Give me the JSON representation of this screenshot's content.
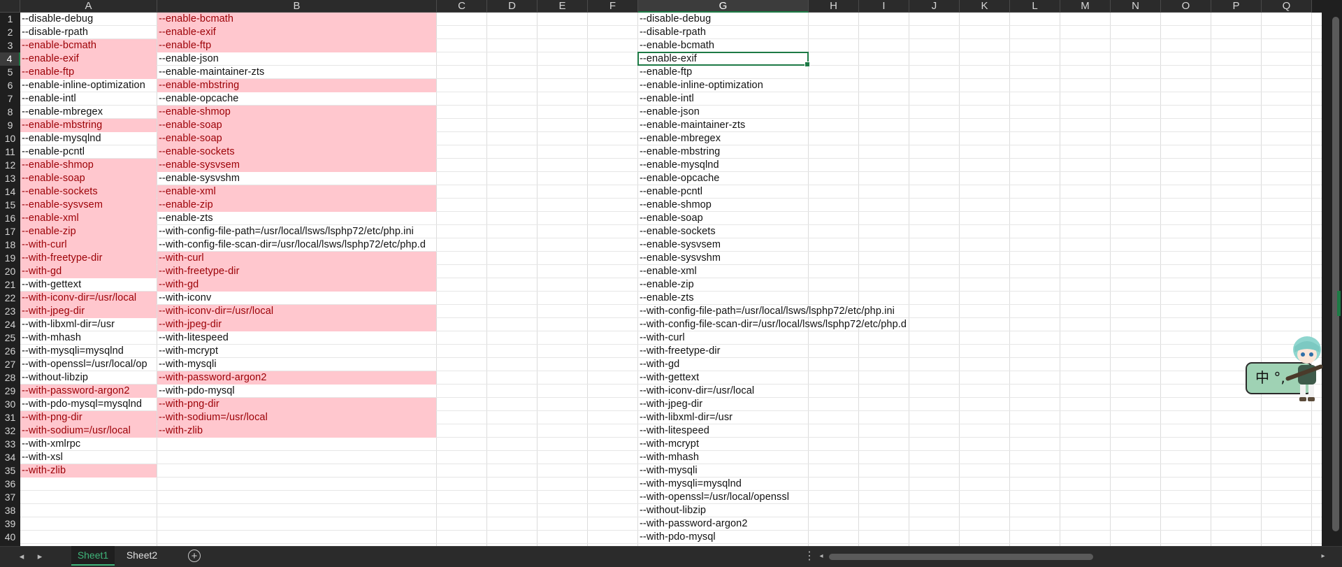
{
  "columns": [
    "A",
    "B",
    "C",
    "D",
    "E",
    "F",
    "G",
    "H",
    "I",
    "J",
    "K",
    "L",
    "M",
    "N",
    "O",
    "P",
    "Q"
  ],
  "selected_column": "G",
  "selected_row": 4,
  "row_numbers": [
    "1",
    "2",
    "3",
    "4",
    "5",
    "6",
    "7",
    "8",
    "9",
    "10",
    "11",
    "12",
    "13",
    "14",
    "15",
    "16",
    "17",
    "18",
    "19",
    "20",
    "21",
    "22",
    "23",
    "24",
    "25",
    "26",
    "27",
    "28",
    "29",
    "30",
    "31",
    "32",
    "33",
    "34",
    "35",
    "36",
    "37",
    "38",
    "39",
    "40"
  ],
  "column_a": [
    {
      "text": "--disable-debug",
      "hl": false
    },
    {
      "text": "--disable-rpath",
      "hl": false
    },
    {
      "text": "--enable-bcmath",
      "hl": true
    },
    {
      "text": "--enable-exif",
      "hl": true
    },
    {
      "text": "--enable-ftp",
      "hl": true
    },
    {
      "text": "--enable-inline-optimization",
      "hl": false
    },
    {
      "text": "--enable-intl",
      "hl": false
    },
    {
      "text": "--enable-mbregex",
      "hl": false
    },
    {
      "text": "--enable-mbstring",
      "hl": true
    },
    {
      "text": "--enable-mysqlnd",
      "hl": false
    },
    {
      "text": "--enable-pcntl",
      "hl": false
    },
    {
      "text": "--enable-shmop",
      "hl": true
    },
    {
      "text": "--enable-soap",
      "hl": true
    },
    {
      "text": "--enable-sockets",
      "hl": true
    },
    {
      "text": "--enable-sysvsem",
      "hl": true
    },
    {
      "text": "--enable-xml",
      "hl": true
    },
    {
      "text": "--enable-zip",
      "hl": true
    },
    {
      "text": "--with-curl",
      "hl": true
    },
    {
      "text": "--with-freetype-dir",
      "hl": true
    },
    {
      "text": "--with-gd",
      "hl": true
    },
    {
      "text": "--with-gettext",
      "hl": false
    },
    {
      "text": "--with-iconv-dir=/usr/local",
      "hl": true
    },
    {
      "text": "--with-jpeg-dir",
      "hl": true
    },
    {
      "text": "--with-libxml-dir=/usr",
      "hl": false
    },
    {
      "text": "--with-mhash",
      "hl": false
    },
    {
      "text": "--with-mysqli=mysqlnd",
      "hl": false
    },
    {
      "text": "--with-openssl=/usr/local/op",
      "hl": false
    },
    {
      "text": "--without-libzip",
      "hl": false
    },
    {
      "text": "--with-password-argon2",
      "hl": true
    },
    {
      "text": "--with-pdo-mysql=mysqlnd",
      "hl": false
    },
    {
      "text": "--with-png-dir",
      "hl": true
    },
    {
      "text": "--with-sodium=/usr/local",
      "hl": true
    },
    {
      "text": "--with-xmlrpc",
      "hl": false
    },
    {
      "text": "--with-xsl",
      "hl": false
    },
    {
      "text": "--with-zlib",
      "hl": true
    }
  ],
  "column_b": [
    {
      "text": "--enable-bcmath",
      "hl": true
    },
    {
      "text": "--enable-exif",
      "hl": true
    },
    {
      "text": "--enable-ftp",
      "hl": true
    },
    {
      "text": "--enable-json",
      "hl": false
    },
    {
      "text": "--enable-maintainer-zts",
      "hl": false
    },
    {
      "text": "--enable-mbstring",
      "hl": true
    },
    {
      "text": "--enable-opcache",
      "hl": false
    },
    {
      "text": "--enable-shmop",
      "hl": true
    },
    {
      "text": "--enable-soap",
      "hl": true
    },
    {
      "text": "--enable-soap",
      "hl": true
    },
    {
      "text": "--enable-sockets",
      "hl": true
    },
    {
      "text": "--enable-sysvsem",
      "hl": true
    },
    {
      "text": "--enable-sysvshm",
      "hl": false
    },
    {
      "text": "--enable-xml",
      "hl": true
    },
    {
      "text": "--enable-zip",
      "hl": true
    },
    {
      "text": "--enable-zts",
      "hl": false
    },
    {
      "text": "--with-config-file-path=/usr/local/lsws/lsphp72/etc/php.ini",
      "hl": false
    },
    {
      "text": "--with-config-file-scan-dir=/usr/local/lsws/lsphp72/etc/php.d",
      "hl": false
    },
    {
      "text": "--with-curl",
      "hl": true
    },
    {
      "text": "--with-freetype-dir",
      "hl": true
    },
    {
      "text": "--with-gd",
      "hl": true
    },
    {
      "text": "--with-iconv",
      "hl": false
    },
    {
      "text": "--with-iconv-dir=/usr/local",
      "hl": true
    },
    {
      "text": "--with-jpeg-dir",
      "hl": true
    },
    {
      "text": "--with-litespeed",
      "hl": false
    },
    {
      "text": "--with-mcrypt",
      "hl": false
    },
    {
      "text": "--with-mysqli",
      "hl": false
    },
    {
      "text": "--with-password-argon2",
      "hl": true
    },
    {
      "text": "--with-pdo-mysql",
      "hl": false
    },
    {
      "text": "--with-png-dir",
      "hl": true
    },
    {
      "text": "--with-sodium=/usr/local",
      "hl": true
    },
    {
      "text": "--with-zlib",
      "hl": true
    }
  ],
  "column_g": [
    "--disable-debug",
    "--disable-rpath",
    "--enable-bcmath",
    "--enable-exif",
    "--enable-ftp",
    "--enable-inline-optimization",
    "--enable-intl",
    "--enable-json",
    "--enable-maintainer-zts",
    "--enable-mbregex",
    "--enable-mbstring",
    "--enable-mysqlnd",
    "--enable-opcache",
    "--enable-pcntl",
    "--enable-shmop",
    "--enable-soap",
    "--enable-sockets",
    "--enable-sysvsem",
    "--enable-sysvshm",
    "--enable-xml",
    "--enable-zip",
    "--enable-zts",
    "--with-config-file-path=/usr/local/lsws/lsphp72/etc/php.ini",
    "--with-config-file-scan-dir=/usr/local/lsws/lsphp72/etc/php.d",
    "--with-curl",
    "--with-freetype-dir",
    "--with-gd",
    "--with-gettext",
    "--with-iconv-dir=/usr/local",
    "--with-jpeg-dir",
    "--with-libxml-dir=/usr",
    "--with-litespeed",
    "--with-mcrypt",
    "--with-mhash",
    "--with-mysqli",
    "--with-mysqli=mysqlnd",
    "--with-openssl=/usr/local/openssl",
    "--without-libzip",
    "--with-password-argon2",
    "--with-pdo-mysql"
  ],
  "sheet_tabs": [
    {
      "label": "Sheet1",
      "active": true
    },
    {
      "label": "Sheet2",
      "active": false
    }
  ],
  "add_sheet_label": "+",
  "ime": {
    "text": "中 °,"
  },
  "colors": {
    "highlight_fill": "#ffc7ce",
    "highlight_text": "#9c0006",
    "accent": "#1d7a45"
  }
}
